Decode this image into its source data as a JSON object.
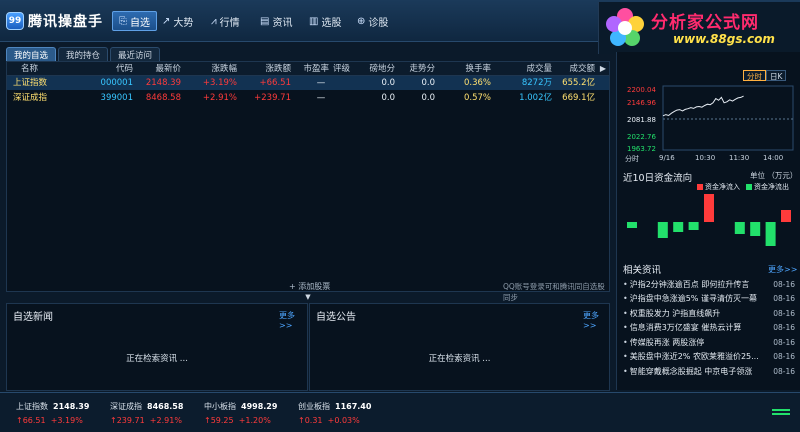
{
  "app": {
    "title": "腾讯操盘手",
    "logo_badge": "99"
  },
  "nav": [
    {
      "label": "自选",
      "icon": "star-list-icon",
      "active": true
    },
    {
      "label": "大势",
      "icon": "trend-icon",
      "active": false
    },
    {
      "label": "行情",
      "icon": "bar-chart-icon",
      "active": false
    },
    {
      "label": "资讯",
      "icon": "news-icon",
      "active": false
    },
    {
      "label": "选股",
      "icon": "stock-pick-icon",
      "active": false
    },
    {
      "label": "诊股",
      "icon": "diagnose-icon",
      "active": false
    }
  ],
  "watermark": {
    "title": "分析家公式网",
    "url": "www.88gs.com"
  },
  "tabs": [
    "我的自选",
    "我的持仓",
    "最近访问"
  ],
  "table": {
    "headers": [
      "名称",
      "代码",
      "最新价",
      "涨跌幅",
      "涨跌额",
      "市盈率",
      "评级",
      "磅地分",
      "走势分",
      "换手率",
      "成交量",
      "成交额"
    ],
    "rows": [
      {
        "name": "上证指数",
        "code": "000001",
        "price": "2148.39",
        "pct": "+3.19%",
        "chg": "+66.51",
        "pe": "—",
        "rating": "",
        "score1": "0.0",
        "score2": "0.0",
        "turnover": "0.36%",
        "volume": "8272万",
        "amount": "655.2亿"
      },
      {
        "name": "深证成指",
        "code": "399001",
        "price": "8468.58",
        "pct": "+2.91%",
        "chg": "+239.71",
        "pe": "—",
        "rating": "",
        "score1": "0.0",
        "score2": "0.0",
        "turnover": "0.57%",
        "volume": "1.002亿",
        "amount": "669.1亿"
      }
    ],
    "add_stock": "+ 添加股票",
    "sync_note": "QQ账号登录可和腾讯同自选股同步"
  },
  "panels": {
    "news": {
      "title": "自选新闻",
      "more": "更多>>",
      "loading": "正在检索资讯 ..."
    },
    "notice": {
      "title": "自选公告",
      "more": "更多>>",
      "loading": "正在检索资讯 ..."
    }
  },
  "intraday": {
    "period_tabs": [
      "分时",
      "日K"
    ],
    "active_period": "分时",
    "y_labels": [
      "2200.04",
      "2146.96",
      "2081.88",
      "2022.76",
      "1963.72"
    ],
    "x_labels": [
      "分时",
      "9/16",
      "10:30",
      "11:30",
      "14:00"
    ],
    "series": [
      2095,
      2100,
      2096,
      2105,
      2112,
      2118,
      2120,
      2115,
      2121,
      2124,
      2128,
      2125,
      2131,
      2133,
      2130,
      2137,
      2142,
      2140,
      2148,
      2165,
      2158,
      2170,
      2148,
      2152,
      2160,
      2155,
      2162,
      2168,
      2170,
      2175
    ]
  },
  "fund_flow": {
    "title": "近10日资金流向",
    "unit": "单位 （万元）",
    "legend_in": "资金净流入",
    "legend_out": "资金净流出",
    "color_in": "#ff3b3b",
    "color_out": "#22e06b",
    "values": [
      -3,
      0,
      -8,
      -5,
      -4,
      14,
      0,
      -6,
      -7,
      -12,
      6
    ]
  },
  "related_news": {
    "title": "相关资讯",
    "more": "更多>>",
    "items": [
      {
        "text": "沪指2分钟涨逾百点 即何拉升传言",
        "date": "08-16"
      },
      {
        "text": "沪指盘中急涨逾5% 谨寻清仿灭一幕",
        "date": "08-16"
      },
      {
        "text": "权重股发力 沪指直线飙升",
        "date": "08-16"
      },
      {
        "text": "信息消费3万亿盛宴 催热云计算",
        "date": "08-16"
      },
      {
        "text": "传媒股再涨 两股涨停",
        "date": "08-16"
      },
      {
        "text": "美股盘中涨近2% 农欧莱雅溢价25...",
        "date": "08-16"
      },
      {
        "text": "智能穿戴概念股掘起 中京电子领涨",
        "date": "08-16"
      }
    ]
  },
  "status_indices": [
    {
      "name": "上证指数",
      "value": "2148.39",
      "chg": "↑66.51",
      "pct": "+3.19%"
    },
    {
      "name": "深证成指",
      "value": "8468.58",
      "chg": "↑239.71",
      "pct": "+2.91%"
    },
    {
      "name": "中小板指",
      "value": "4998.29",
      "chg": "↑59.25",
      "pct": "+1.20%"
    },
    {
      "name": "创业板指",
      "value": "1167.40",
      "chg": "↑0.31",
      "pct": "+0.03%"
    }
  ]
}
